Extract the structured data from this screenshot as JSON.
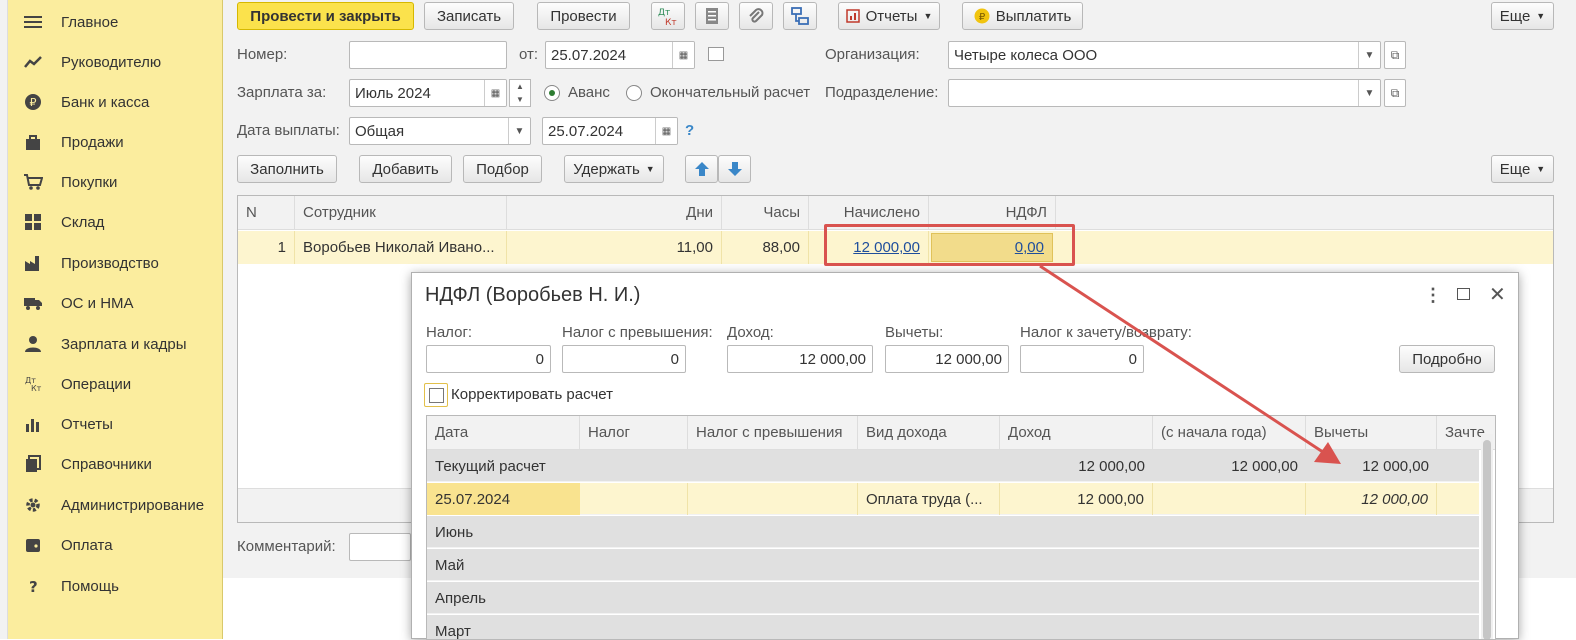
{
  "sidebar": {
    "items": [
      {
        "label": "Главное",
        "icon": "menu-icon"
      },
      {
        "label": "Руководителю",
        "icon": "trend-icon"
      },
      {
        "label": "Банк и касса",
        "icon": "ruble-coin-icon"
      },
      {
        "label": "Продажи",
        "icon": "shopping-bag-icon"
      },
      {
        "label": "Покупки",
        "icon": "cart-icon"
      },
      {
        "label": "Склад",
        "icon": "warehouse-icon"
      },
      {
        "label": "Производство",
        "icon": "factory-icon"
      },
      {
        "label": "ОС и НМА",
        "icon": "truck-icon"
      },
      {
        "label": "Зарплата и кадры",
        "icon": "person-icon"
      },
      {
        "label": "Операции",
        "icon": "dt-kt-icon"
      },
      {
        "label": "Отчеты",
        "icon": "bar-chart-icon"
      },
      {
        "label": "Справочники",
        "icon": "books-icon"
      },
      {
        "label": "Администрирование",
        "icon": "gear-icon"
      },
      {
        "label": "Оплата",
        "icon": "wallet-icon"
      },
      {
        "label": "Помощь",
        "icon": "question-icon"
      }
    ]
  },
  "toolbar": {
    "post_close": "Провести и закрыть",
    "save": "Записать",
    "post": "Провести",
    "dtkt": "ДтКт",
    "reports": "Отчеты",
    "pay": "Выплатить",
    "more": "Еще"
  },
  "form": {
    "number_label": "Номер:",
    "number_value": "",
    "from_label": "от:",
    "from_date": "25.07.2024",
    "org_label": "Организация:",
    "org_value": "Четыре колеса ООО",
    "salary_label": "Зарплата за:",
    "salary_month": "Июль 2024",
    "advance_label": "Аванс",
    "final_label": "Окончательный расчет",
    "dept_label": "Подразделение:",
    "dept_value": "",
    "pay_date_label": "Дата выплаты:",
    "pay_date_type": "Общая",
    "pay_date": "25.07.2024",
    "help": "?",
    "comment_label": "Комментарий:"
  },
  "table_toolbar": {
    "fill": "Заполнить",
    "add": "Добавить",
    "pick": "Подбор",
    "withhold": "Удержать",
    "more": "Еще"
  },
  "grid": {
    "headers": [
      "N",
      "Сотрудник",
      "Дни",
      "Часы",
      "Начислено",
      "НДФЛ"
    ],
    "row": {
      "n": "1",
      "employee": "Воробьев Николай Ивано...",
      "days": "11,00",
      "hours": "88,00",
      "accrued": "12 000,00",
      "ndfl": "0,00"
    }
  },
  "dialog": {
    "title": "НДФЛ (Воробьев Н. И.)",
    "tax_label": "Налог:",
    "tax_value": "0",
    "excess_label": "Налог с превышения:",
    "excess_value": "0",
    "income_label": "Доход:",
    "income_value": "12 000,00",
    "deductions_label": "Вычеты:",
    "deductions_value": "12 000,00",
    "offset_label": "Налог к зачету/возврату:",
    "offset_value": "0",
    "details_button": "Подробно",
    "correct_label": "Корректировать расчет",
    "columns": [
      "Дата",
      "Налог",
      "Налог с превышения",
      "Вид дохода",
      "Доход",
      "(с начала года)",
      "Вычеты",
      "Зачте"
    ],
    "rows": [
      {
        "date": "Текущий расчет",
        "tax": "",
        "excess": "",
        "kind": "",
        "income": "12 000,00",
        "ytd": "12 000,00",
        "deductions": "12 000,00"
      },
      {
        "date": "25.07.2024",
        "tax": "",
        "excess": "",
        "kind": "Оплата труда (...",
        "income": "12 000,00",
        "ytd": "",
        "deductions": "12 000,00"
      },
      {
        "date": "Июнь"
      },
      {
        "date": "Май"
      },
      {
        "date": "Апрель"
      },
      {
        "date": "Март"
      }
    ]
  },
  "colors": {
    "accent_yellow": "#fbe24c",
    "sidebar_yellow": "#fbed9e",
    "highlight_red": "#d9534f",
    "link_blue": "#1f4e9c"
  }
}
